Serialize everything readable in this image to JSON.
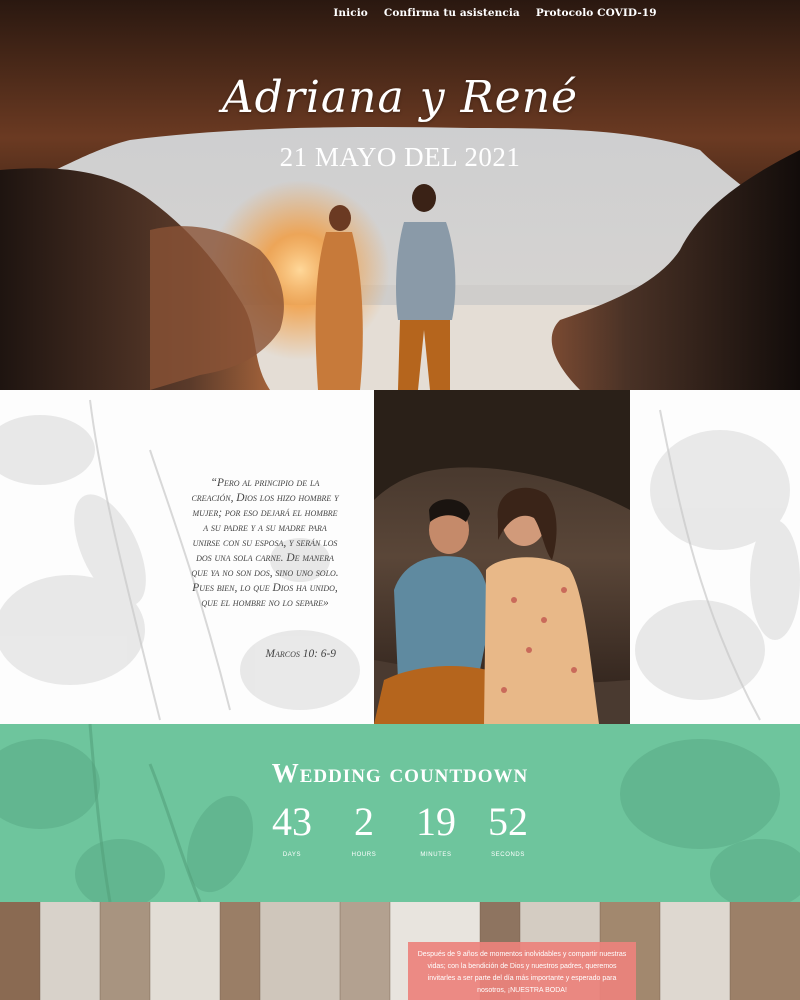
{
  "nav": {
    "items": [
      {
        "label": "Inicio"
      },
      {
        "label": "Confirma tu asistencia"
      },
      {
        "label": "Protocolo COVID-19"
      }
    ]
  },
  "hero": {
    "names": "Adriana y René",
    "date": "21 MAYO DEL 2021"
  },
  "quote": {
    "text": "“Pero al principio de la creación, Dios los hizo hombre y mujer; por eso dejará el hombre a su padre y a su madre para unirse con su esposa, y serán los dos una sola carne. De manera que ya no son dos, sino uno solo. Pues bien, lo que Dios ha unido, que el hombre no lo separe»",
    "reference": "Marcos 10: 6-9"
  },
  "countdown": {
    "title": "Wedding countdown",
    "units": [
      {
        "value": "43",
        "label": "DAYS"
      },
      {
        "value": "2",
        "label": "HOURS"
      },
      {
        "value": "19",
        "label": "MINUTES"
      },
      {
        "value": "52",
        "label": "SECONDS"
      }
    ]
  },
  "message": {
    "text": "Después de 9 años de momentos inolvidables y compartir nuestras vidas; con la bendición de Dios y nuestros padres, queremos invitarles a ser parte del día más importante y esperado para nosotros, ¡NUESTRA BODA!"
  },
  "colors": {
    "countdown_bg": "#6ec59d",
    "message_bg": "#ec827c"
  }
}
